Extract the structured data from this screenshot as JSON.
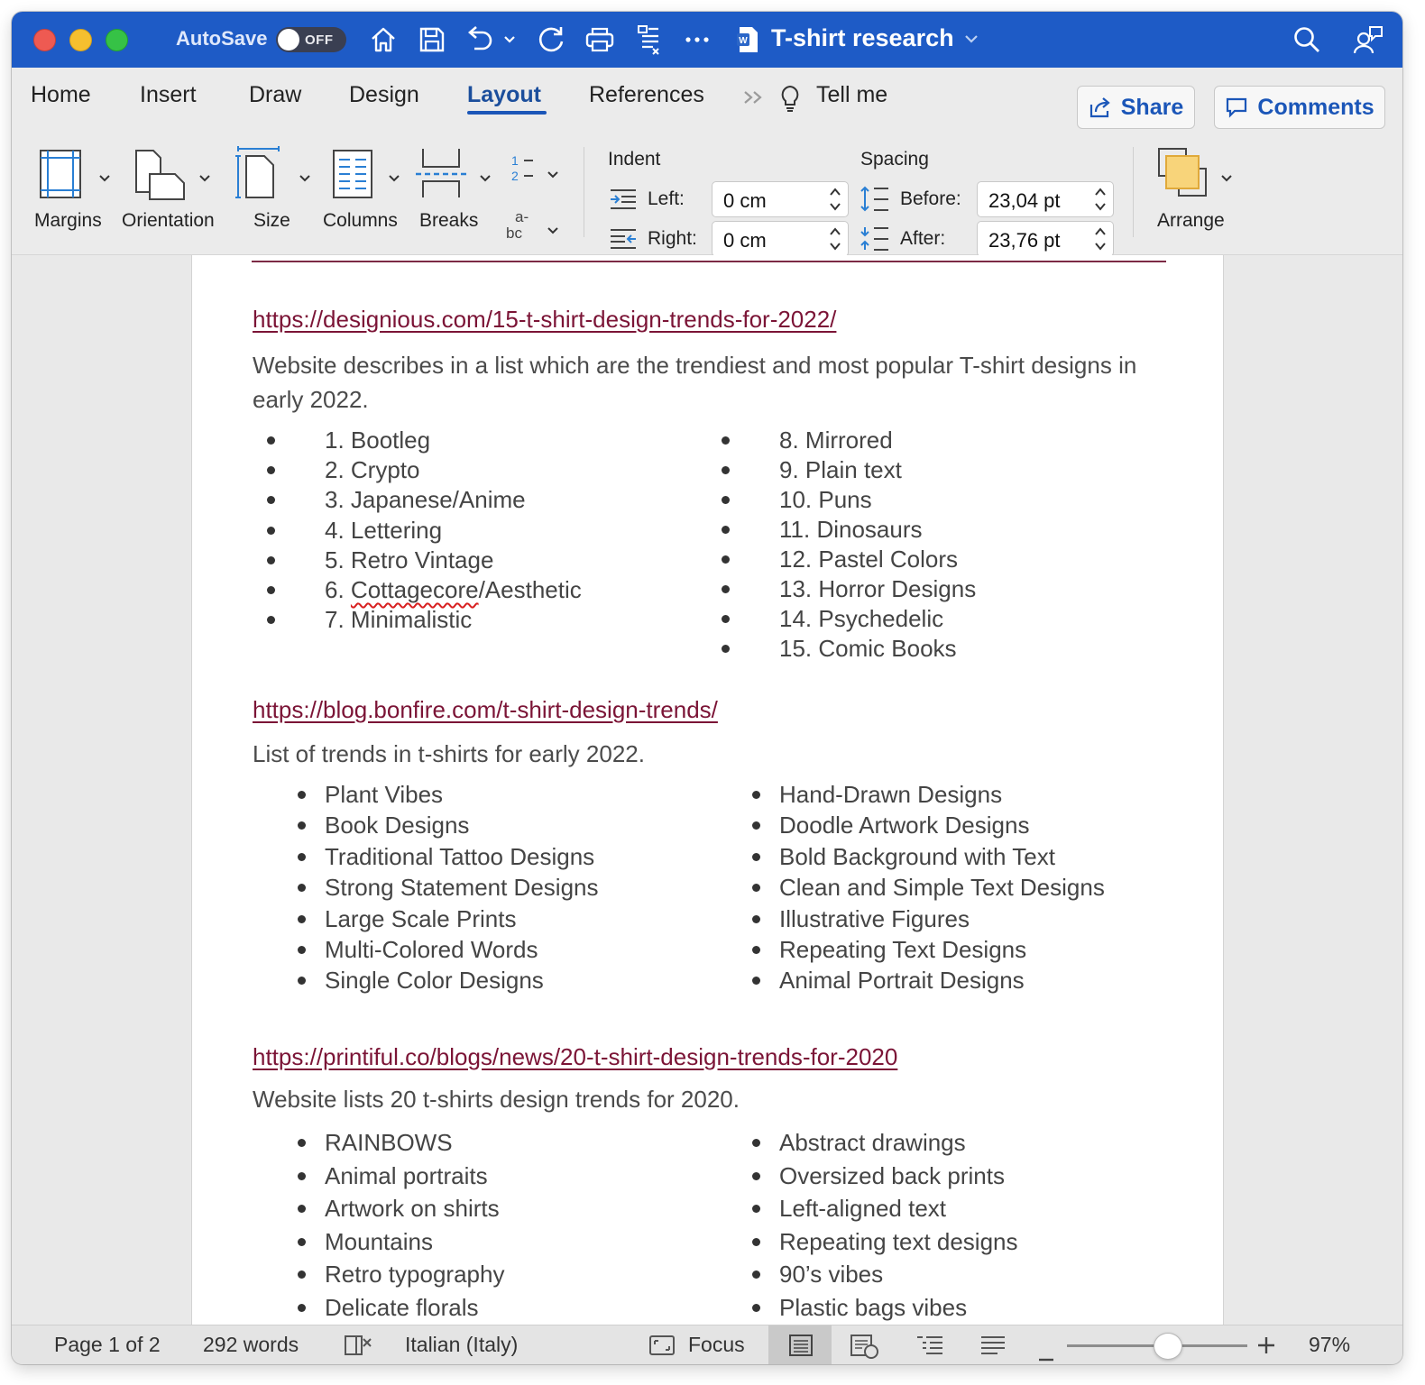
{
  "titlebar": {
    "autosave_label": "AutoSave",
    "autosave_state": "OFF",
    "doc_title": "T-shirt research",
    "icons": [
      "home-icon",
      "save-icon",
      "undo-icon",
      "redo-icon",
      "print-icon",
      "outline-icon",
      "more-icon",
      "word-doc-icon",
      "search-icon",
      "share-people-icon"
    ]
  },
  "tabs": {
    "home": "Home",
    "insert": "Insert",
    "draw": "Draw",
    "design": "Design",
    "layout": "Layout",
    "references": "References",
    "tell_me": "Tell me",
    "share": "Share",
    "comments": "Comments"
  },
  "ribbon": {
    "margins": "Margins",
    "orientation": "Orientation",
    "size": "Size",
    "columns": "Columns",
    "breaks": "Breaks",
    "line_numbers_glyph": "1-\n2-",
    "hyphenation_glyph_top": "a-",
    "hyphenation_glyph_bottom": "bc",
    "indent_title": "Indent",
    "indent_left_label": "Left:",
    "indent_left_value": "0 cm",
    "indent_right_label": "Right:",
    "indent_right_value": "0 cm",
    "spacing_title": "Spacing",
    "spacing_before_label": "Before:",
    "spacing_before_value": "23,04 pt",
    "spacing_after_label": "After:",
    "spacing_after_value": "23,76 pt",
    "arrange": "Arrange"
  },
  "document": {
    "section1": {
      "link": "https://designious.com/15-t-shirt-design-trends-for-2022/",
      "description": "Website describes in a list which are the trendiest and most popular T-shirt designs in early 2022.",
      "left_items": [
        "1. Bootleg",
        "2. Crypto",
        "3. Japanese/Anime",
        "4. Lettering",
        "5. Retro Vintage",
        "6. Cottagecore/Aesthetic",
        "7. Minimalistic"
      ],
      "right_items": [
        "8. Mirrored",
        "9. Plain text",
        "10. Puns",
        "11. Dinosaurs",
        "12. Pastel Colors",
        "13. Horror Designs",
        "14. Psychedelic",
        "15. Comic Books"
      ],
      "spell_word": "Cottagecore"
    },
    "section2": {
      "link": "https://blog.bonfire.com/t-shirt-design-trends/",
      "description": "List of trends in t-shirts for early 2022.",
      "left_items": [
        "Plant Vibes",
        "Book Designs",
        "Traditional Tattoo Designs",
        "Strong Statement Designs",
        "Large Scale Prints",
        "Multi-Colored Words",
        "Single Color Designs"
      ],
      "right_items": [
        "Hand-Drawn Designs",
        "Doodle Artwork Designs",
        "Bold Background with Text",
        "Clean and Simple Text Designs",
        "Illustrative Figures",
        "Repeating Text Designs",
        "Animal Portrait Designs"
      ]
    },
    "section3": {
      "link": "https://printiful.co/blogs/news/20-t-shirt-design-trends-for-2020",
      "description": "Website lists 20 t-shirts design trends for 2020.",
      "left_items": [
        "RAINBOWS",
        "Animal portraits",
        "Artwork on shirts",
        "Mountains",
        "Retro typography",
        "Delicate florals"
      ],
      "right_items": [
        "Abstract drawings",
        "Oversized back prints",
        "Left-aligned text",
        "Repeating text designs",
        "90’s vibes",
        "Plastic bags vibes"
      ]
    }
  },
  "statusbar": {
    "page": "Page 1 of 2",
    "words": "292 words",
    "language": "Italian (Italy)",
    "focus": "Focus",
    "zoom": "97%",
    "zoom_level": 0.5
  },
  "colors": {
    "titlebar": "#1e5bc6",
    "accent": "#1b56b8",
    "link": "#7b1436"
  }
}
